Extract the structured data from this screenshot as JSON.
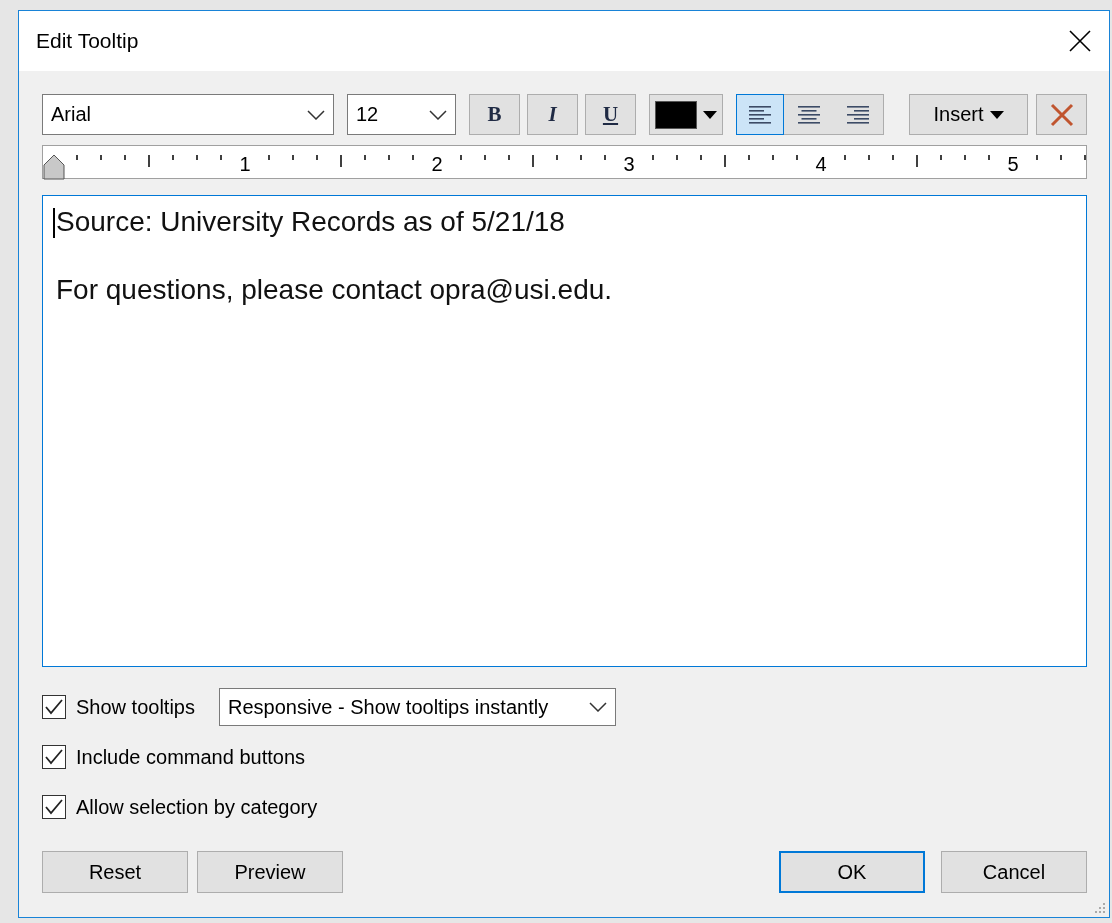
{
  "window": {
    "title": "Edit Tooltip"
  },
  "toolbar": {
    "font": {
      "value": "Arial"
    },
    "size": {
      "value": "12"
    },
    "format_buttons": [
      {
        "label": "B",
        "kind": "bold",
        "selected": false
      },
      {
        "label": "I",
        "kind": "italic",
        "selected": false
      },
      {
        "label": "U",
        "kind": "underline",
        "selected": false
      }
    ],
    "text_color": {
      "color": "#000000"
    },
    "align_buttons": [
      {
        "kind": "left",
        "selected": true
      },
      {
        "kind": "center",
        "selected": false
      },
      {
        "kind": "right",
        "selected": false
      }
    ],
    "insert_button": "Insert"
  },
  "ruler": {
    "labels": [
      "1",
      "2",
      "3",
      "4",
      "5"
    ]
  },
  "editor": {
    "paragraphs": [
      "Source: University Records as of 5/21/18",
      "For questions, please contact opra@usi.edu."
    ]
  },
  "options": [
    {
      "label": "Show tooltips",
      "checked": true,
      "dropdown": "Responsive - Show tooltips instantly"
    },
    {
      "label": "Include command buttons",
      "checked": true
    },
    {
      "label": "Allow selection by category",
      "checked": true
    }
  ],
  "buttons_left": [
    "Reset",
    "Preview"
  ],
  "buttons_right": [
    {
      "label": "OK",
      "default": true
    },
    {
      "label": "Cancel",
      "default": false
    }
  ]
}
